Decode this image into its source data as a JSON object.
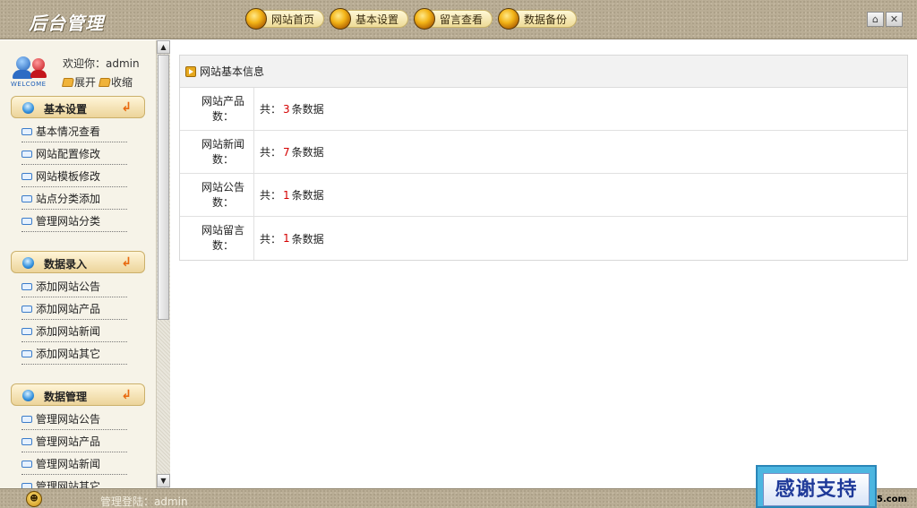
{
  "header": {
    "logo": "后台管理",
    "nav": [
      "网站首页",
      "基本设置",
      "留言查看",
      "数据备份"
    ],
    "win_home": "⌂",
    "win_close": "✕"
  },
  "sidebar": {
    "welcome_badge": "WELCOME",
    "greeting": "欢迎你：admin",
    "expand": "展开",
    "collapse": "收缩",
    "sections": [
      {
        "title": "基本设置",
        "items": [
          "基本情况查看",
          "网站配置修改",
          "网站模板修改",
          "站点分类添加",
          "管理网站分类"
        ]
      },
      {
        "title": "数据录入",
        "items": [
          "添加网站公告",
          "添加网站产品",
          "添加网站新闻",
          "添加网站其它"
        ]
      },
      {
        "title": "数据管理",
        "items": [
          "管理网站公告",
          "管理网站产品",
          "管理网站新闻",
          "管理网站其它"
        ]
      }
    ]
  },
  "main": {
    "panel_title": "网站基本信息",
    "rows": [
      {
        "label": "网站产品数：",
        "prefix": "共：",
        "count": "3",
        "suffix": "条数据"
      },
      {
        "label": "网站新闻数：",
        "prefix": "共：",
        "count": "7",
        "suffix": "条数据"
      },
      {
        "label": "网站公告数：",
        "prefix": "共：",
        "count": "1",
        "suffix": "条数据"
      },
      {
        "label": "网站留言数：",
        "prefix": "共：",
        "count": "1",
        "suffix": "条数据"
      }
    ]
  },
  "footer": {
    "login_text": "管理登陆：admin",
    "tag": "5.com"
  },
  "overlay": {
    "text": "感谢支持"
  },
  "colors": {
    "accent_red": "#d40000",
    "topbar": "#b9ad95",
    "sidebar_bg": "#f6f3e8"
  }
}
